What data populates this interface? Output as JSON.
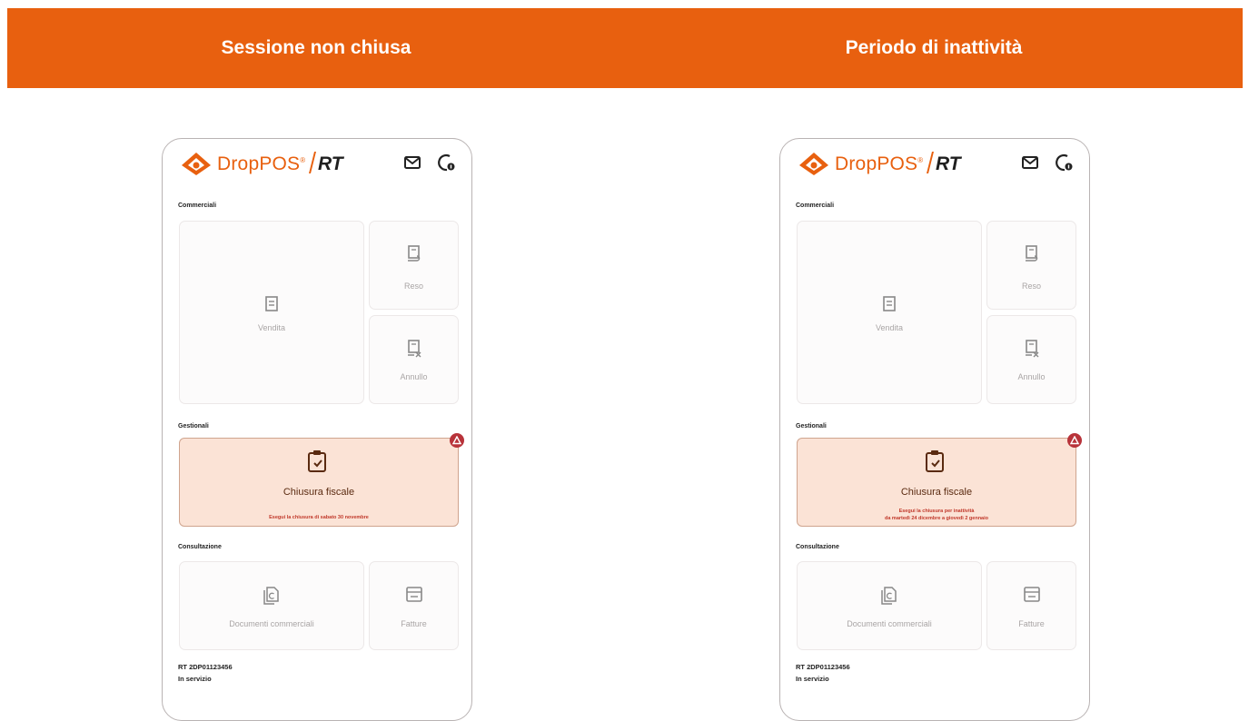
{
  "banner": {
    "left_title": "Sessione non chiusa",
    "right_title": "Periodo di inattività"
  },
  "phones": [
    {
      "logo": {
        "brand": "DropPOS",
        "trademark": "®",
        "suffix": "RT"
      },
      "sections": {
        "commercial": "Commerciali",
        "management": "Gestionali",
        "consultation": "Consultazione"
      },
      "tiles": {
        "sale": "Vendita",
        "return": "Reso",
        "cancel": "Annullo",
        "documents": "Documenti commerciali",
        "invoices": "Fatture"
      },
      "fiscal": {
        "title": "Chiusura fiscale",
        "subtitle_line1": "Esegui la chiusura di sabato 30 novembre",
        "subtitle_line2": ""
      },
      "footer": {
        "rt_id": "RT 2DP01123456",
        "status": "In servizio"
      }
    },
    {
      "logo": {
        "brand": "DropPOS",
        "trademark": "®",
        "suffix": "RT"
      },
      "sections": {
        "commercial": "Commerciali",
        "management": "Gestionali",
        "consultation": "Consultazione"
      },
      "tiles": {
        "sale": "Vendita",
        "return": "Reso",
        "cancel": "Annullo",
        "documents": "Documenti commerciali",
        "invoices": "Fatture"
      },
      "fiscal": {
        "title": "Chiusura fiscale",
        "subtitle_line1": "Esegui la chiusura per inattività",
        "subtitle_line2": "da martedì 24 dicembre a giovedì 2 gennaio"
      },
      "footer": {
        "rt_id": "RT 2DP01123456",
        "status": "In servizio"
      }
    }
  ],
  "colors": {
    "brand_orange": "#e8600f",
    "alert_red": "#b8333a",
    "fiscal_bg": "#fbe3d6"
  },
  "icons": [
    "mail-icon",
    "support-icon",
    "receipt-icon",
    "receipt-return-icon",
    "receipt-cancel-icon",
    "clipboard-check-icon",
    "document-euro-icon",
    "invoice-icon",
    "warning-icon"
  ]
}
